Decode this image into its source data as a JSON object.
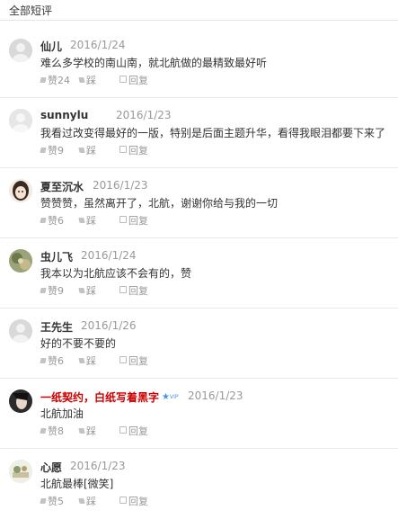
{
  "header": {
    "title": "全部短评"
  },
  "actions": {
    "dislike": "踩",
    "reply": "回复"
  },
  "comments": [
    {
      "name": "仙儿",
      "date": "2016/1/24",
      "text": "难么多学校的南山南，就北航做的最精致最好听",
      "likes": "赞24"
    },
    {
      "name": "sunnylu",
      "date": "2016/1/23",
      "text": "我看过改变得最好的一版，特别是后面主题升华，看得我眼泪都要下来了",
      "likes": "赞9"
    },
    {
      "name": "夏至沉水",
      "date": "2016/1/23",
      "text": "赞赞赞，虽然离开了，北航，谢谢你给与我的一切",
      "likes": "赞6"
    },
    {
      "name": "虫儿飞",
      "date": "2016/1/24",
      "text": "我本以为北航应该不会有的，赞",
      "likes": "赞9"
    },
    {
      "name": "王先生",
      "date": "2016/1/26",
      "text": "好的不要不要的",
      "likes": "赞6"
    },
    {
      "name": "一纸契约，白纸写着黑字",
      "date": "2016/1/23",
      "text": "北航加油",
      "likes": "赞8",
      "red": true
    },
    {
      "name": "心愿",
      "date": "2016/1/23",
      "text": "北航最棒[微笑]",
      "likes": "赞5"
    }
  ],
  "colors": {
    "accent_name": "#cc0000",
    "muted": "#999999",
    "text": "#333333"
  },
  "icons": [
    "like-icon",
    "dislike-icon",
    "reply-icon",
    "vip-icon"
  ]
}
